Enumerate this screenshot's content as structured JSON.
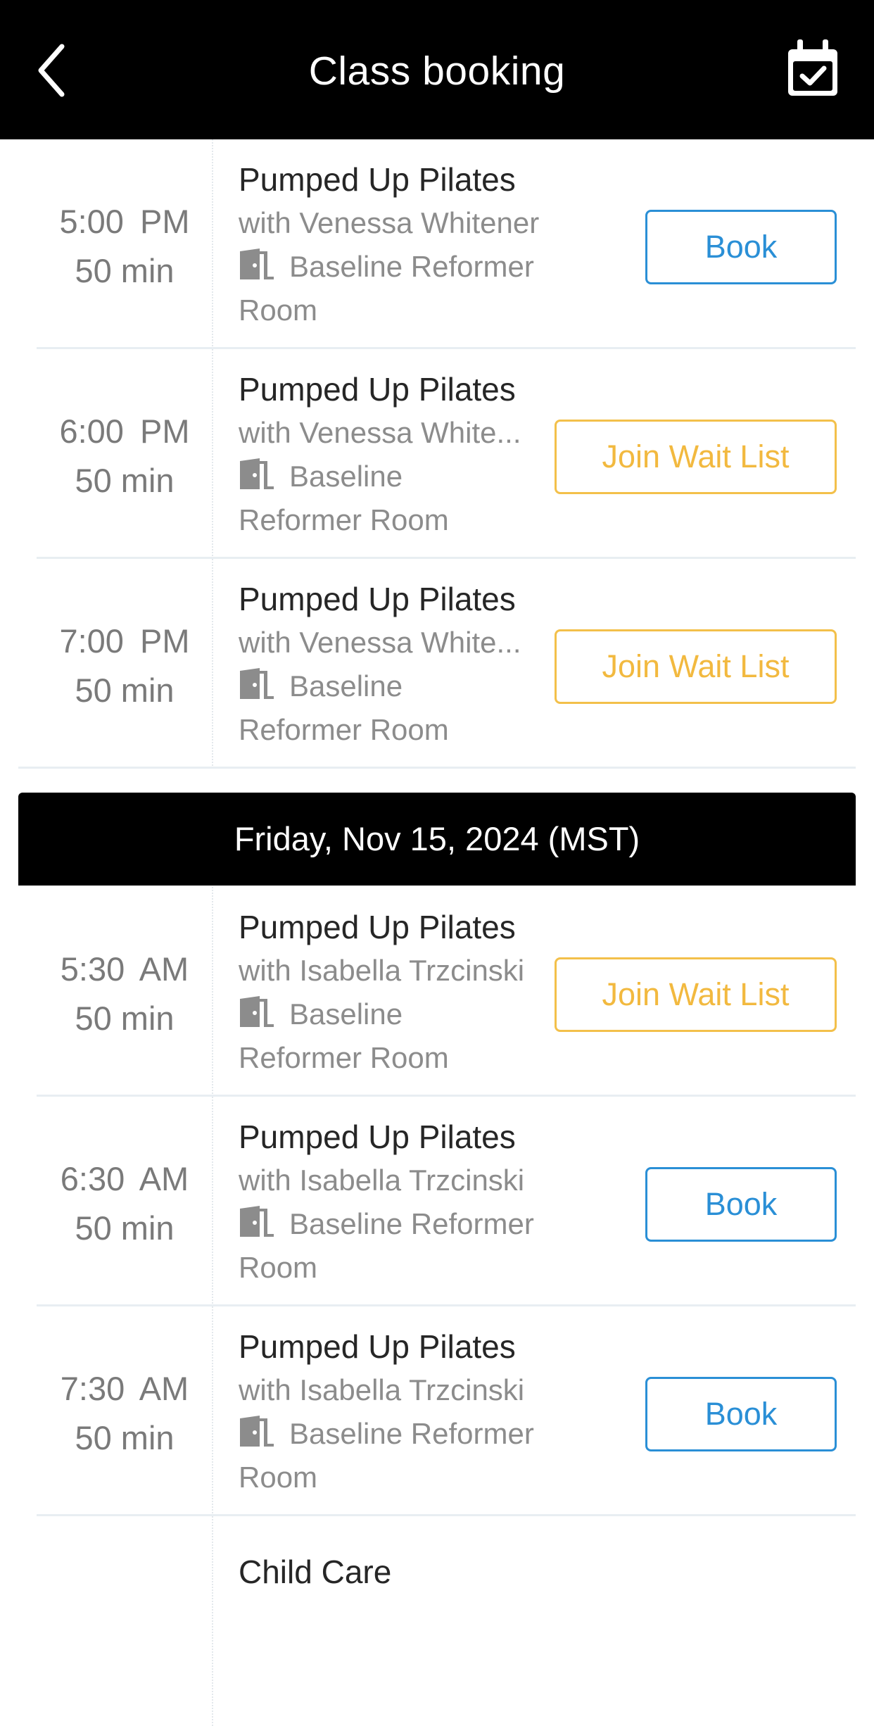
{
  "header": {
    "title": "Class booking",
    "back_icon": "chevron-left-icon",
    "calendar_icon": "calendar-check-icon"
  },
  "colors": {
    "book": "#2a8fd6",
    "wait": "#f2b93f",
    "header_bg": "#000000"
  },
  "sections": [
    {
      "classes": [
        {
          "time": "5:00  PM",
          "duration": "50 min",
          "name": "Pumped Up Pilates",
          "instructor": "with Venessa Whitener",
          "room_line1": "Baseline Reformer",
          "room_line2": "Room",
          "action": "Book"
        },
        {
          "time": "6:00  PM",
          "duration": "50 min",
          "name": "Pumped Up Pilates",
          "instructor": "with Venessa White...",
          "room_line1": "Baseline",
          "room_line2": "Reformer Room",
          "action": "Join Wait List"
        },
        {
          "time": "7:00  PM",
          "duration": "50 min",
          "name": "Pumped Up Pilates",
          "instructor": "with Venessa White...",
          "room_line1": "Baseline",
          "room_line2": "Reformer Room",
          "action": "Join Wait List"
        }
      ]
    },
    {
      "day": "Friday, Nov 15, 2024 (MST)",
      "classes": [
        {
          "time": "5:30  AM",
          "duration": "50 min",
          "name": "Pumped Up Pilates",
          "instructor": "with Isabella Trzcinski",
          "room_line1": "Baseline",
          "room_line2": "Reformer Room",
          "action": "Join Wait List"
        },
        {
          "time": "6:30  AM",
          "duration": "50 min",
          "name": "Pumped Up Pilates",
          "instructor": "with Isabella Trzcinski",
          "room_line1": "Baseline Reformer",
          "room_line2": "Room",
          "action": "Book"
        },
        {
          "time": "7:30  AM",
          "duration": "50 min",
          "name": "Pumped Up Pilates",
          "instructor": "with Isabella Trzcinski",
          "room_line1": "Baseline Reformer",
          "room_line2": "Room",
          "action": "Book"
        },
        {
          "name": "Child Care"
        }
      ]
    }
  ]
}
